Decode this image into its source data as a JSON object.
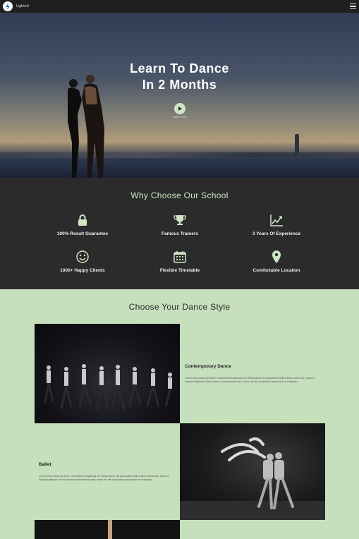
{
  "header": {
    "brand": "Lighted"
  },
  "hero": {
    "title_line1": "Learn To Dance",
    "title_line2": "In 2 Months",
    "play_label": "Watch Video"
  },
  "why": {
    "title": "Why Choose Our School",
    "features": [
      {
        "label": "100% Result Guarantee",
        "icon": "lock-icon"
      },
      {
        "label": "Famous Trainers",
        "icon": "trophy-icon"
      },
      {
        "label": "3 Years Of Experience",
        "icon": "chart-icon"
      },
      {
        "label": "1000+ Happy Clients",
        "icon": "smile-icon"
      },
      {
        "label": "Flexible Timetable",
        "icon": "calendar-icon"
      },
      {
        "label": "Comfortable Location",
        "icon": "map-pin-icon"
      }
    ]
  },
  "styles": {
    "title": "Choose Your Dance Style",
    "items": [
      {
        "name": "Contemporary Dance",
        "text": "Lorem ipsum dolor sit amet, consectetur adipiscing elit. Officia iaculi nisi quibusdam dolore ilitas doloremae, quae ut, aliquam asipiscer. Enim ducimus assumenda esse, natus est nisi obcasatum aspernatur ut explicabo."
      },
      {
        "name": "Ballet",
        "text": "Lorem ipsum dolor sit amet, consectetur adipiscing elit. Officia iaculi nisi quibusdam dolore ilitas doloremae, quae ut, aliquam asipiscer. Enim ducimus assumenda esse, natus est nisi obcasatum aspernatur ut explicabo."
      }
    ]
  },
  "colors": {
    "accent": "#cfe6c4",
    "dark": "#2b2b2c",
    "light_section": "#c6dfbc"
  }
}
